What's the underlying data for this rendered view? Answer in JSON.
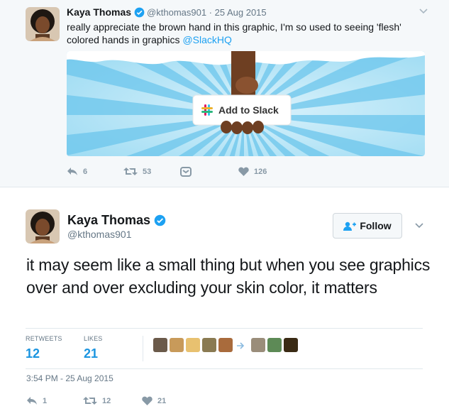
{
  "parent_tweet": {
    "name": "Kaya Thomas",
    "meta": "@kthomas901 · 25 Aug 2015",
    "text_pre": "really appreciate the brown hand in this graphic, I'm so used to seeing 'flesh' colored hands in graphics ",
    "mention": "@SlackHQ",
    "media_button": "Add to Slack",
    "actions": {
      "reply": "6",
      "retweet": "53",
      "like": "126"
    }
  },
  "tweet": {
    "name": "Kaya Thomas",
    "handle": "@kthomas901",
    "follow_label": "Follow",
    "text": "it may seem like a small thing but when you see graphics over and over excluding your skin color, it matters",
    "stats": {
      "retweets_label": "RETWEETS",
      "retweets_value": "12",
      "likes_label": "LIKES",
      "likes_value": "21"
    },
    "timestamp": "3:54 PM - 25 Aug 2015",
    "actions": {
      "reply": "1",
      "retweet": "12",
      "like": "21"
    }
  },
  "colors": {
    "accent": "#1da1f2",
    "count": "#1b95e0",
    "muted": "#8899a6",
    "verified": "#1da1f2"
  },
  "icons": [
    "verified-icon",
    "chevron-down-icon",
    "reply-icon",
    "retweet-icon",
    "dm-icon",
    "like-icon",
    "follow-icon",
    "slack-logo-icon"
  ]
}
